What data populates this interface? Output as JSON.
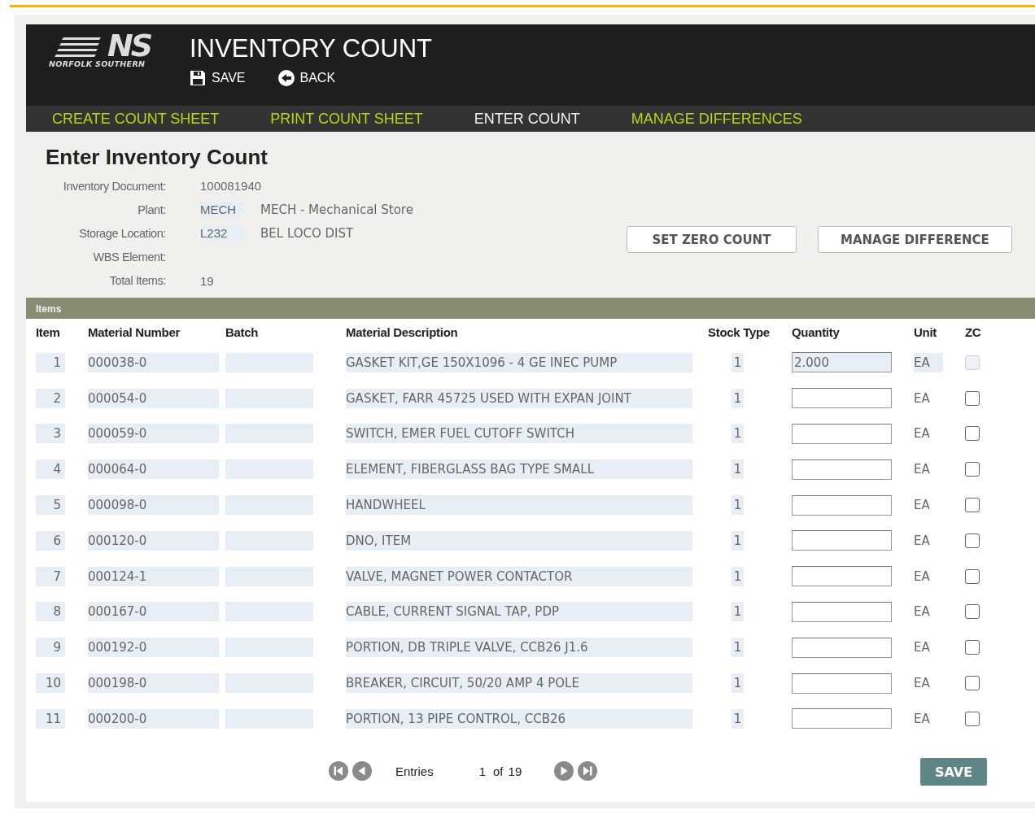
{
  "header": {
    "logo": {
      "mark": "NS",
      "tagline": "NORFOLK SOUTHERN"
    },
    "title": "INVENTORY COUNT",
    "actions": [
      {
        "kind": "save",
        "label": "SAVE"
      },
      {
        "kind": "back",
        "label": "BACK"
      }
    ]
  },
  "nav": [
    {
      "label": "CREATE COUNT SHEET",
      "selected": false
    },
    {
      "label": "PRINT COUNT SHEET",
      "selected": false
    },
    {
      "label": "ENTER COUNT",
      "selected": true
    },
    {
      "label": "MANAGE DIFFERENCES",
      "selected": false
    }
  ],
  "page_title": "Enter Inventory Count",
  "details": [
    {
      "label": "Inventory Document:",
      "value": "100081940"
    },
    {
      "label": "Plant:",
      "value": "MECH",
      "description": "MECH - Mechanical Store"
    },
    {
      "label": "Storage Location:",
      "value": "L232",
      "description": "BEL LOCO DIST"
    },
    {
      "label": "WBS Element:"
    },
    {
      "label": "Total Items:",
      "value": "19"
    }
  ],
  "buttons": [
    "SET ZERO COUNT",
    "MANAGE DIFFERENCE"
  ],
  "items": {
    "title": "Items",
    "columns": [
      "Item",
      "Material Number",
      "Batch",
      "Material Description",
      "Stock Type",
      "Quantity",
      "Unit",
      "ZC"
    ],
    "rows": [
      {
        "item": "1",
        "material_number": "000038-0",
        "description": "GASKET KIT,GE 150X1096 - 4 GE INEC PUMP",
        "stock_type": "1",
        "quantity": "2.000",
        "unit": "EA",
        "zc": false,
        "disabled": true
      },
      {
        "item": "2",
        "material_number": "000054-0",
        "description": "GASKET, FARR 45725 USED WITH EXPAN JOINT",
        "stock_type": "1",
        "unit": "EA",
        "zc": false,
        "disabled": false
      },
      {
        "item": "3",
        "material_number": "000059-0",
        "description": "SWITCH,  EMER FUEL CUTOFF SWITCH",
        "stock_type": "1",
        "unit": "EA",
        "zc": false,
        "disabled": false
      },
      {
        "item": "4",
        "material_number": "000064-0",
        "description": "ELEMENT, FIBERGLASS BAG TYPE SMALL",
        "stock_type": "1",
        "unit": "EA",
        "zc": false,
        "disabled": false
      },
      {
        "item": "5",
        "material_number": "000098-0",
        "description": "HANDWHEEL",
        "stock_type": "1",
        "unit": "EA",
        "zc": false,
        "disabled": false
      },
      {
        "item": "6",
        "material_number": "000120-0",
        "description": "DNO, ITEM",
        "stock_type": "1",
        "unit": "EA",
        "zc": false,
        "disabled": false
      },
      {
        "item": "7",
        "material_number": "000124-1",
        "description": "VALVE, MAGNET POWER CONTACTOR",
        "stock_type": "1",
        "unit": "EA",
        "zc": false,
        "disabled": false
      },
      {
        "item": "8",
        "material_number": "000167-0",
        "description": "CABLE, CURRENT SIGNAL TAP, PDP",
        "stock_type": "1",
        "unit": "EA",
        "zc": false,
        "disabled": false
      },
      {
        "item": "9",
        "material_number": "000192-0",
        "description": "PORTION, DB TRIPLE VALVE, CCB26 J1.6",
        "stock_type": "1",
        "unit": "EA",
        "zc": false,
        "disabled": false
      },
      {
        "item": "10",
        "material_number": "000198-0",
        "description": "BREAKER, CIRCUIT, 50/20 AMP 4 POLE",
        "stock_type": "1",
        "unit": "EA",
        "zc": false,
        "disabled": false
      },
      {
        "item": "11",
        "material_number": "000200-0",
        "description": "PORTION, 13 PIPE CONTROL, CCB26",
        "stock_type": "1",
        "unit": "EA",
        "zc": false,
        "disabled": false
      }
    ]
  },
  "pager": {
    "label": "Entries",
    "current": "1",
    "of": "of",
    "total": "19"
  },
  "save_button": "SAVE"
}
